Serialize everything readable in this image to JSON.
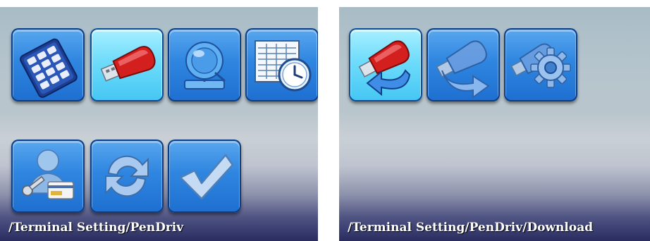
{
  "left_screen": {
    "path": "/Terminal Setting/PenDriv",
    "icons": [
      {
        "name": "keypad-icon",
        "selected": false
      },
      {
        "name": "pen-drive-icon",
        "selected": true
      },
      {
        "name": "bell-icon",
        "selected": false
      },
      {
        "name": "schedule-clock-icon",
        "selected": false
      },
      {
        "name": "user-card-key-icon",
        "selected": false
      },
      {
        "name": "sync-arrows-icon",
        "selected": false
      },
      {
        "name": "checkmark-icon",
        "selected": false
      }
    ]
  },
  "right_screen": {
    "path": "/Terminal Setting/PenDriv/Download",
    "icons": [
      {
        "name": "pen-drive-download-icon",
        "selected": true
      },
      {
        "name": "pen-drive-upload-icon",
        "selected": false
      },
      {
        "name": "pen-drive-settings-icon",
        "selected": false
      }
    ]
  },
  "colors": {
    "button_blue": "#2f86e0",
    "button_selected": "#6fdcfb",
    "usb_red": "#d41f1f",
    "label_text": "#ffffff"
  }
}
